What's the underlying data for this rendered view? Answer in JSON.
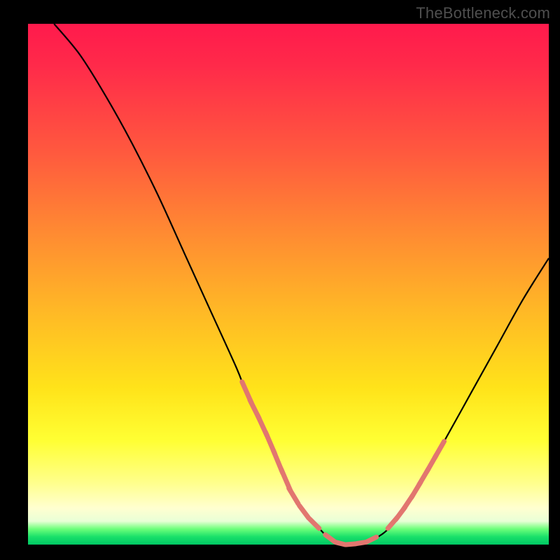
{
  "watermark": "TheBottleneck.com",
  "colors": {
    "background": "#000000",
    "curve": "#000000",
    "marker": "#e2766f",
    "gradient_stops": [
      "#ff1a4c",
      "#ff5a3e",
      "#ffb826",
      "#ffff33",
      "#ffffd0",
      "#19e06a"
    ]
  },
  "chart_data": {
    "type": "line",
    "title": "",
    "xlabel": "",
    "ylabel": "",
    "xlim": [
      0,
      100
    ],
    "ylim": [
      0,
      100
    ],
    "grid": false,
    "legend": false,
    "x": [
      5,
      10,
      15,
      20,
      25,
      30,
      35,
      40,
      42,
      45,
      48,
      50,
      53,
      56,
      58,
      60,
      62,
      65,
      68,
      70,
      73,
      76,
      80,
      85,
      90,
      95,
      100
    ],
    "values": [
      100,
      94,
      86,
      77,
      67,
      56,
      45,
      34,
      29,
      23,
      16,
      11,
      6,
      3,
      1,
      0,
      0,
      0.5,
      2,
      4,
      8,
      13,
      20,
      29,
      38,
      47,
      55
    ],
    "markers": {
      "comment": "dashed/segmented pink markers near the trough in two clusters",
      "left_cluster_x": [
        42,
        43.5,
        45,
        46.5,
        48,
        49.5,
        51,
        53,
        55,
        58,
        60,
        62,
        64,
        66
      ],
      "right_cluster_x": [
        70,
        71.5,
        73,
        74.5,
        76,
        77.5,
        79
      ]
    }
  }
}
